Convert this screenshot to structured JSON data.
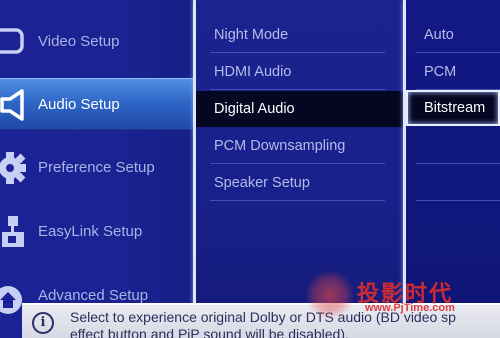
{
  "left_menu": {
    "items": [
      {
        "label": "Video Setup",
        "icon": "screen-icon"
      },
      {
        "label": "Audio Setup",
        "icon": "speaker-icon",
        "selected": true
      },
      {
        "label": "Preference Setup",
        "icon": "gear-icon"
      },
      {
        "label": "EasyLink Setup",
        "icon": "easylink-icon"
      },
      {
        "label": "Advanced Setup",
        "icon": "home-icon"
      }
    ]
  },
  "middle_menu": {
    "items": [
      {
        "label": "Night Mode"
      },
      {
        "label": "HDMI Audio"
      },
      {
        "label": "Digital Audio",
        "selected": true
      },
      {
        "label": "PCM Downsampling"
      },
      {
        "label": "Speaker Setup"
      }
    ]
  },
  "options": {
    "items": [
      {
        "label": "Auto"
      },
      {
        "label": "PCM"
      },
      {
        "label": "Bitstream",
        "selected": true
      }
    ]
  },
  "info": {
    "line1": "Select to experience original Dolby or DTS audio (BD video sp",
    "line2": "effect button and PiP sound will be disabled)."
  },
  "watermark": {
    "chinese": "投影时代",
    "url": "www.PjTime.com"
  },
  "colors": {
    "background": "#121a7e",
    "highlight": "#3a78d8",
    "selected_row": "#040622",
    "info_bar": "#e2e3ec",
    "watermark": "#dc2d2d"
  }
}
